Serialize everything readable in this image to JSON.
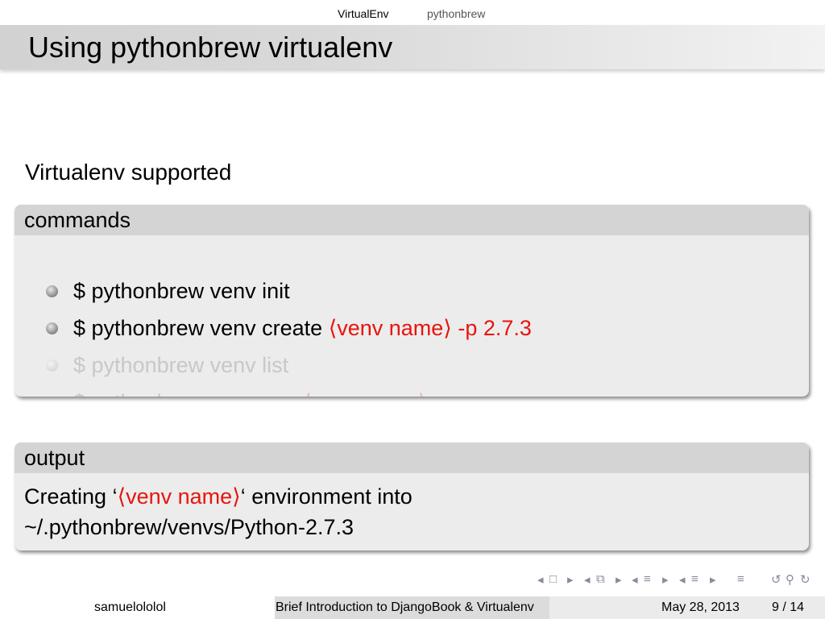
{
  "nav": {
    "sections": [
      "VirtualEnv",
      "pythonbrew"
    ],
    "active": "VirtualEnv"
  },
  "slide": {
    "title": "Using pythonbrew virtualenv",
    "intro": "Virtualenv supported",
    "commands_block": {
      "heading": "commands",
      "items": [
        {
          "prefix": "$ pythonbrew venv init",
          "arg": "",
          "suffix": "",
          "state": "shown"
        },
        {
          "prefix": "$ pythonbrew venv create ",
          "arg": "⟨venv name⟩",
          "suffix": " -p 2.7.3",
          "state": "shown"
        },
        {
          "prefix": "$ pythonbrew venv list",
          "arg": "",
          "suffix": "",
          "state": "faded"
        },
        {
          "prefix": "$ pythonbrew venv use ",
          "arg": "⟨venv name⟩",
          "suffix": "",
          "state": "faded"
        }
      ]
    },
    "output_block": {
      "heading": "output",
      "line1_prefix": "Creating ‘",
      "line1_arg": "⟨venv name⟩",
      "line1_suffix": "‘ environment into",
      "line2": "~/.pythonbrew/venvs/Python-2.7.3"
    }
  },
  "footer": {
    "author": "samuelololol",
    "talk_title": "Brief Introduction to DjangoBook & Virtualenv",
    "date": "May 28, 2013",
    "page": "9 / 14"
  },
  "colors": {
    "accent_red": "#e8140e",
    "block_body": "#ececec",
    "block_head": "#d4d4d4"
  },
  "nav_icons": [
    "nav-prev-frame-icon",
    "nav-frame-icon",
    "nav-next-frame-icon",
    "nav-prev-subsection-icon",
    "nav-subsection-icon",
    "nav-next-subsection-icon",
    "nav-prev-section-icon",
    "nav-section-icon",
    "nav-next-section-icon",
    "nav-doc-icon",
    "nav-back-icon",
    "nav-search-icon",
    "nav-forward-icon"
  ]
}
